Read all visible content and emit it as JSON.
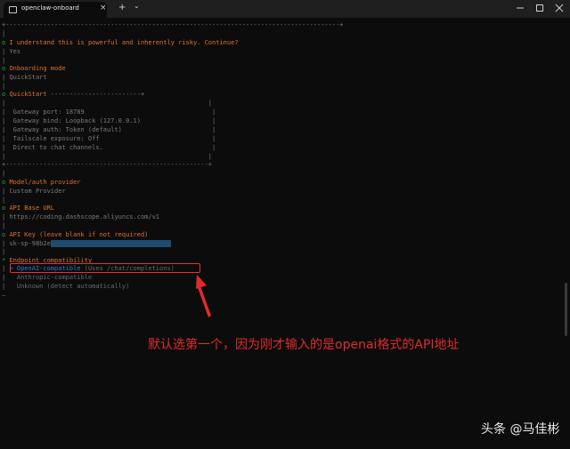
{
  "window": {
    "tab_title": "openclaw-onboard",
    "close_tab": "×",
    "new_tab": "+",
    "dropdown": "⌄"
  },
  "terminal": {
    "lines": [
      {
        "id": "border-top",
        "text": "+-----------------------------------------------------------------------------------------+"
      },
      {
        "id": "bar1",
        "text": "|"
      },
      {
        "id": "risk-q",
        "prefix": "o ",
        "text": "I understand this is powerful and inherently risky. Continue?"
      },
      {
        "id": "risk-a",
        "prefix": "| ",
        "text": "Yes"
      },
      {
        "id": "bar2",
        "text": "|"
      },
      {
        "id": "mode-q",
        "prefix": "o ",
        "text": "Onboarding mode"
      },
      {
        "id": "mode-a",
        "prefix": "| ",
        "text": "QuickStart"
      },
      {
        "id": "bar3",
        "text": "|"
      },
      {
        "id": "qs-head",
        "prefix": "o ",
        "text": "QuickStart",
        "rule": " ------------------------+"
      },
      {
        "id": "qs-blank1",
        "text": "|                                                      |"
      },
      {
        "id": "qs-port",
        "text": "|  Gateway port: 18789                                  |"
      },
      {
        "id": "qs-bind",
        "text": "|  Gateway bind: Loopback (127.0.0.1)                   |"
      },
      {
        "id": "qs-auth",
        "text": "|  Gateway auth: Token (default)                        |"
      },
      {
        "id": "qs-tail",
        "text": "|  Tailscale exposure: Off                              |"
      },
      {
        "id": "qs-direct",
        "text": "|  Direct to chat channels.                             |"
      },
      {
        "id": "qs-blank2",
        "text": "|                                                      |"
      },
      {
        "id": "qs-bottom",
        "text": "+------------------------------------------------------+"
      },
      {
        "id": "bar4",
        "text": "|"
      },
      {
        "id": "prov-q",
        "prefix": "o ",
        "text": "Model/auth provider"
      },
      {
        "id": "prov-a",
        "prefix": "| ",
        "text": "Custom Provider"
      },
      {
        "id": "bar5",
        "text": "|"
      },
      {
        "id": "url-q",
        "prefix": "o ",
        "text": "API Base URL"
      },
      {
        "id": "url-a",
        "prefix": "| ",
        "text": "https://coding.dashscope.aliyuncs.com/v1"
      },
      {
        "id": "bar6",
        "text": "|"
      },
      {
        "id": "key-q",
        "prefix": "o ",
        "text": "API Key (leave blank if not required)"
      },
      {
        "id": "key-a",
        "prefix": "| ",
        "text": "sk-sp-98b2e",
        "masked": "xxxxxxxxxxxxxxxxxxxxxxxxxxxxxxxx"
      },
      {
        "id": "bar7",
        "text": "|"
      },
      {
        "id": "ep-q",
        "prefix": "* ",
        "text": "Endpoint compatibility"
      },
      {
        "id": "ep-opt1",
        "prefix": "| ",
        "text": "> OpenAI-compatible",
        "hint": " (Uses /chat/completions)"
      },
      {
        "id": "ep-opt2",
        "prefix": "| ",
        "text": "  Anthropic-compatible"
      },
      {
        "id": "ep-opt3",
        "prefix": "| ",
        "text": "  Unknown (detect automatically)"
      },
      {
        "id": "end",
        "text": "—"
      }
    ]
  },
  "annotation": "默认选第一个，因为刚才输入的是openai格式的API地址",
  "watermark": "头条 @马佳彬",
  "colors": {
    "question": "#e0702a",
    "answer": "#7a7a7a",
    "marker": "#2ea043",
    "highlight": "#e33333",
    "option_active": "#2f7bd8"
  }
}
